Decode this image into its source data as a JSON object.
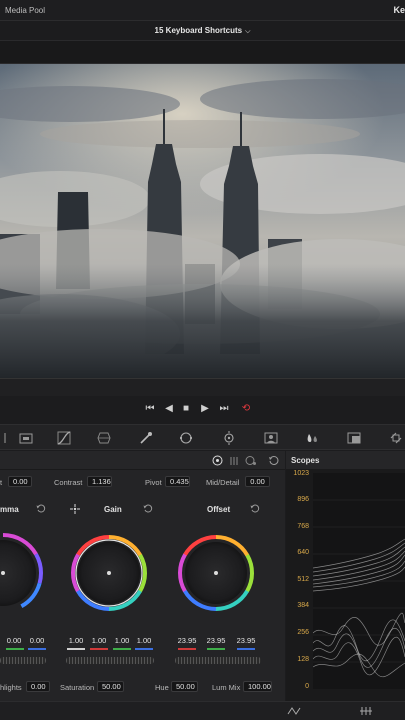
{
  "topbar": {
    "media_pool": "Media Pool",
    "right_cut": "Ke"
  },
  "title": {
    "text": "15 Keyboard Shortcuts"
  },
  "primaries": {
    "row1": [
      {
        "label": "t",
        "value": "0.00"
      },
      {
        "label": "Contrast",
        "value": "1.136"
      },
      {
        "label": "Pivot",
        "value": "0.435"
      },
      {
        "label": "Mid/Detail",
        "value": "0.00"
      }
    ],
    "wheels": [
      {
        "title": "mma",
        "values": [
          "0.00",
          "0.00"
        ]
      },
      {
        "title": "Gain",
        "values": [
          "1.00",
          "1.00",
          "1.00",
          "1.00"
        ]
      },
      {
        "title": "Offset",
        "values": [
          "23.95",
          "23.95",
          "23.95"
        ]
      }
    ],
    "row2": [
      {
        "label": "hlights",
        "value": "0.00"
      },
      {
        "label": "Saturation",
        "value": "50.00"
      },
      {
        "label": "Hue",
        "value": "50.00"
      },
      {
        "label": "Lum Mix",
        "value": "100.00"
      }
    ]
  },
  "scopes": {
    "title": "Scopes",
    "ticks": [
      "1023",
      "896",
      "768",
      "640",
      "512",
      "384",
      "256",
      "128",
      "0"
    ]
  },
  "colors": {
    "accent_red": "#e0383e",
    "tick_gold": "#d9a94a"
  }
}
